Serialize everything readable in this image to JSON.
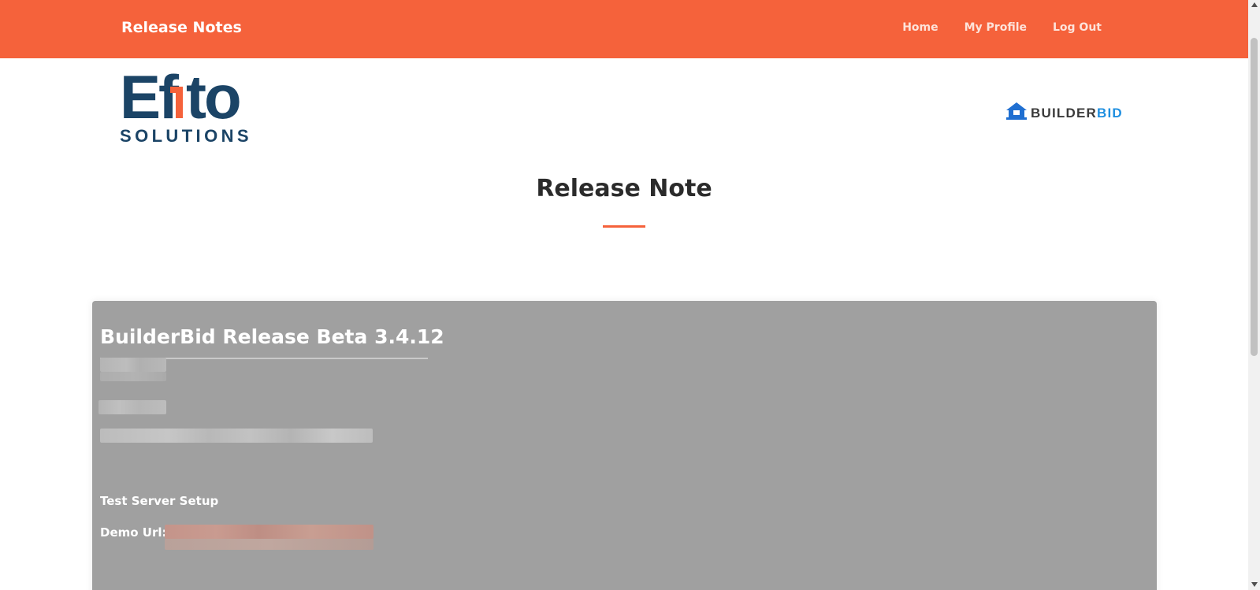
{
  "navbar": {
    "brand": "Release Notes",
    "links": [
      {
        "label": "Home"
      },
      {
        "label": "My Profile"
      },
      {
        "label": "Log Out"
      }
    ],
    "color": "#f5623b"
  },
  "logos": {
    "efito": {
      "word": "Efito",
      "sub": "SOLUTIONS"
    },
    "builderbid": {
      "word_dark": "BUILDER",
      "word_blue": "BID"
    }
  },
  "page": {
    "title": "Release Note"
  },
  "card": {
    "heading": "BuilderBid Release Beta 3.4.12",
    "test_server_label": "Test Server Setup",
    "demo_url_label": "Demo Url:"
  }
}
